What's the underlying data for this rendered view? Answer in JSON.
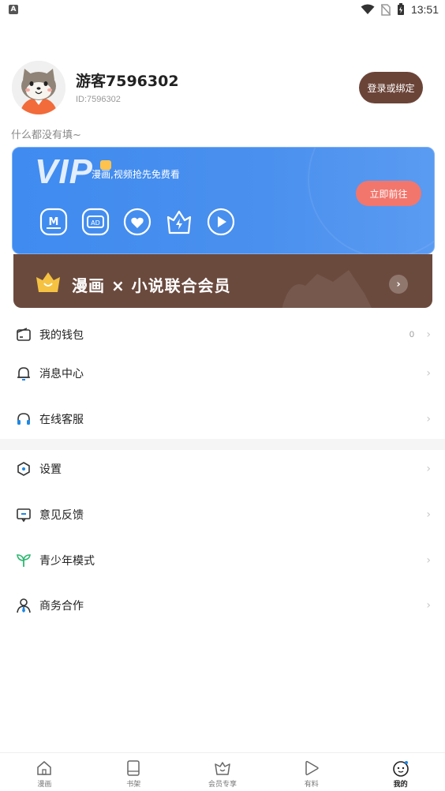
{
  "status_bar": {
    "app_icon_letter": "A",
    "time": "13:51"
  },
  "profile": {
    "username": "游客7596302",
    "user_id": "ID:7596302",
    "login_button": "登录或绑定",
    "bio": "什么都没有填~"
  },
  "vip_card": {
    "watermark": "VIP",
    "promo_text": "漫画,视频抢先免费看",
    "go_button": "立即前往",
    "accent_color": "#4a90ee",
    "privilege_icons": [
      "manga-icon",
      "ad-free-icon",
      "heart-icon",
      "crown-icon",
      "video-play-icon"
    ]
  },
  "joint_banner": {
    "text": "漫画 × 小说联合会员",
    "color": "#6b4a3e"
  },
  "menu": {
    "items": [
      {
        "label": "我的钱包",
        "count": "0",
        "icon": "wallet-icon"
      },
      {
        "label": "消息中心",
        "icon": "bell-icon"
      },
      {
        "label": "在线客服",
        "icon": "headset-icon"
      },
      {
        "label": "设置",
        "icon": "settings-icon"
      },
      {
        "label": "意见反馈",
        "icon": "feedback-icon"
      },
      {
        "label": "青少年模式",
        "icon": "sprout-icon"
      },
      {
        "label": "商务合作",
        "icon": "business-icon"
      }
    ]
  },
  "bottom_nav": {
    "tabs": [
      {
        "label": "漫画",
        "icon": "home-icon"
      },
      {
        "label": "书架",
        "icon": "bookshelf-icon"
      },
      {
        "label": "会员专享",
        "icon": "vip-basket-icon"
      },
      {
        "label": "有料",
        "icon": "play-icon"
      },
      {
        "label": "我的",
        "icon": "profile-face-icon",
        "active": true
      }
    ]
  }
}
